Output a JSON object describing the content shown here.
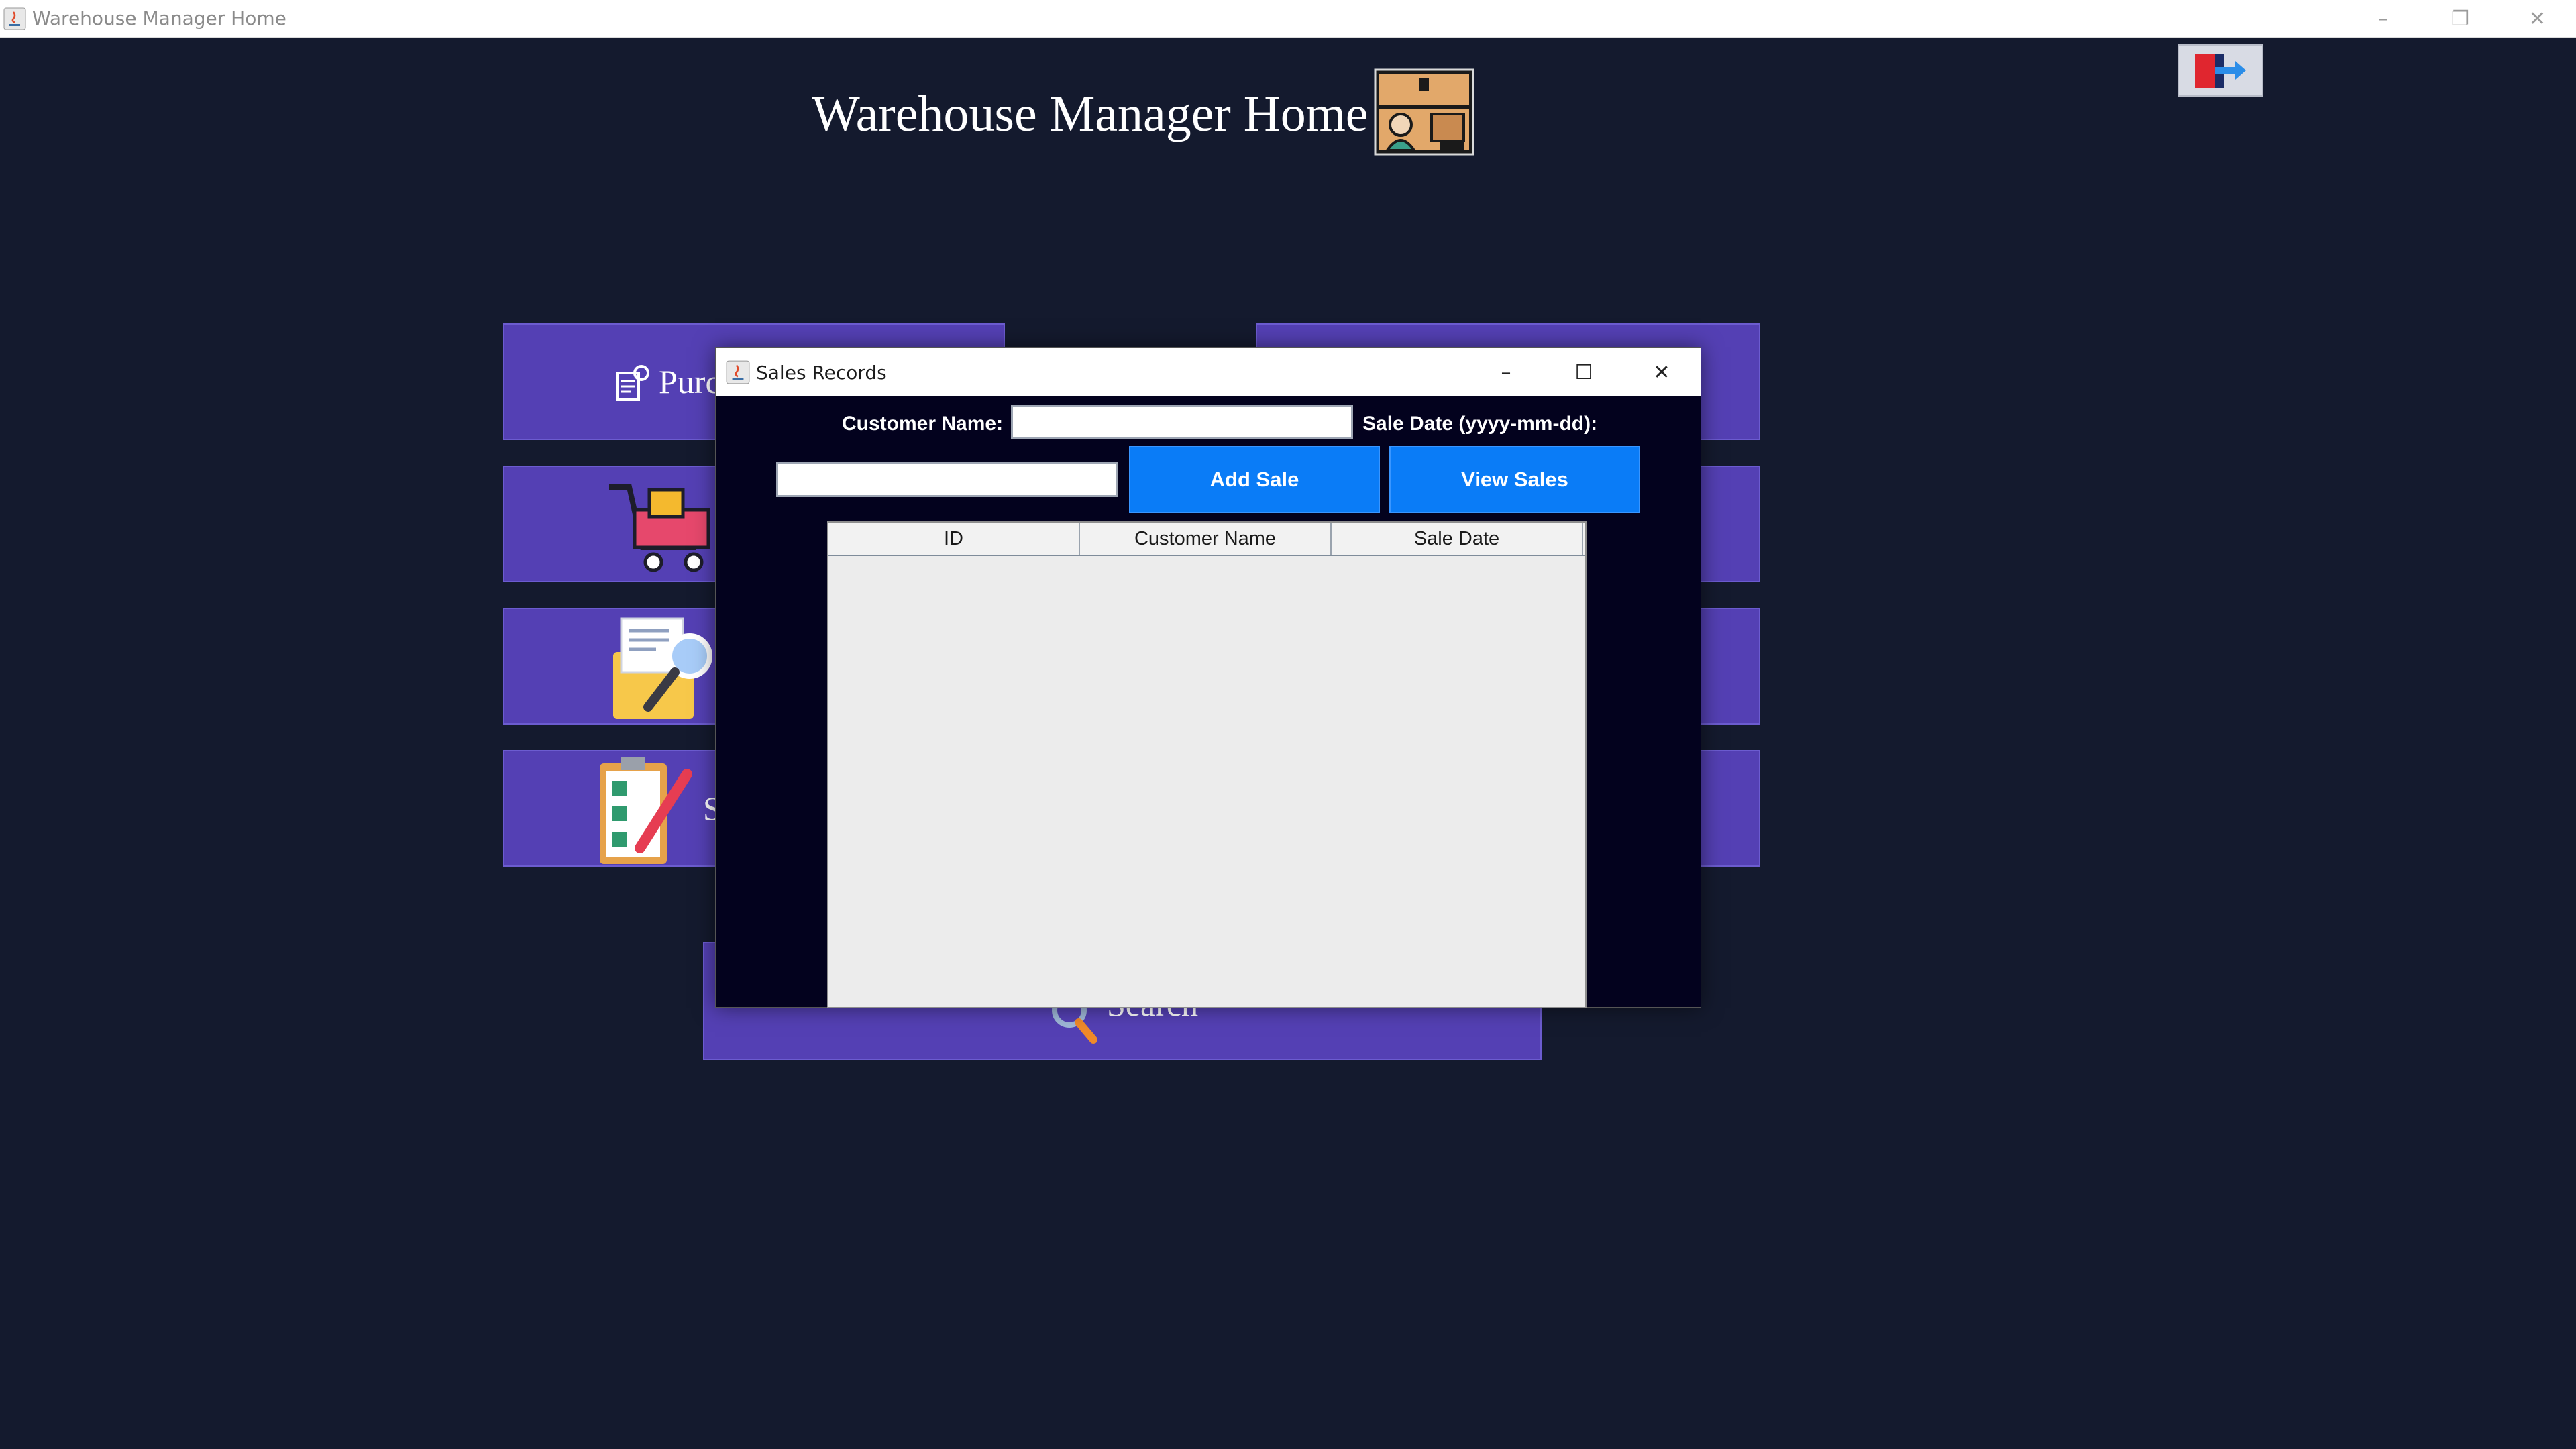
{
  "window": {
    "title": "Warehouse Manager Home",
    "controls": {
      "minimize": "–",
      "maximize": "❐",
      "close": "✕"
    }
  },
  "home": {
    "title": "Warehouse Manager Home",
    "icons": {
      "header": "warehouse-manager-icon",
      "logout": "logout-icon"
    }
  },
  "tiles": [
    {
      "label": "Purc",
      "icon": "purchase-icon"
    },
    {
      "label": "",
      "icon": "shopping-cart-icon"
    },
    {
      "label": "",
      "icon": "folder-search-icon"
    },
    {
      "label": "S",
      "icon": "checklist-icon"
    },
    {
      "label": "Search",
      "icon": "search-icon"
    }
  ],
  "dialog": {
    "title": "Sales Records",
    "controls": {
      "minimize": "–",
      "maximize": "☐",
      "close": "✕"
    },
    "customer_name_label": "Customer Name:",
    "customer_name_value": "",
    "sale_date_label": "Sale Date (yyyy-mm-dd):",
    "sale_date_value": "",
    "add_sale_label": "Add Sale",
    "view_sales_label": "View Sales",
    "table": {
      "columns": [
        "ID",
        "Customer Name",
        "Sale Date"
      ],
      "rows": []
    }
  },
  "colors": {
    "background": "#141a2e",
    "tile": "#5440b4",
    "dialog_bg": "#03021e",
    "button": "#0a7cf7"
  }
}
